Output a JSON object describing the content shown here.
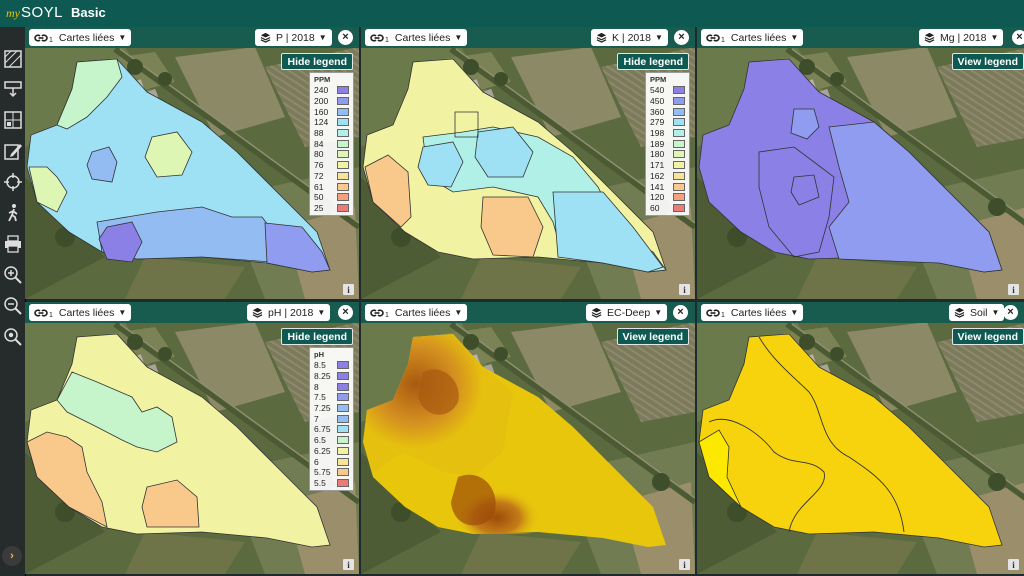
{
  "app": {
    "brand_prefix": "my",
    "brand": "SOYL",
    "plan": "Basic"
  },
  "toolbar": {
    "icons": [
      "map-draw-icon",
      "tray-download-icon",
      "grid-select-icon",
      "edit-icon",
      "crosshair-icon",
      "walking-person-icon",
      "printer-icon",
      "zoom-in-icon",
      "zoom-out-icon",
      "zoom-extent-icon"
    ],
    "toggle_label": "›"
  },
  "panels": [
    {
      "link_label": "Cartes liées",
      "link_count": "1",
      "layer_label": "P | 2018",
      "close_label": "×",
      "legend_button": "Hide legend",
      "legend_visible": true,
      "legend": {
        "unit": "PPM",
        "items": [
          {
            "value": "240",
            "color": "#8a80e6"
          },
          {
            "value": "200",
            "color": "#8f9cef"
          },
          {
            "value": "160",
            "color": "#92bcf2"
          },
          {
            "value": "124",
            "color": "#9ee0f4"
          },
          {
            "value": "88",
            "color": "#b0f0e6"
          },
          {
            "value": "84",
            "color": "#c6f5cc"
          },
          {
            "value": "80",
            "color": "#ddf6b4"
          },
          {
            "value": "76",
            "color": "#f2f3a2"
          },
          {
            "value": "72",
            "color": "#f7e496"
          },
          {
            "value": "61",
            "color": "#f8c98a"
          },
          {
            "value": "50",
            "color": "#f5a27c"
          },
          {
            "value": "25",
            "color": "#ee7a78"
          }
        ]
      },
      "info_label": "i"
    },
    {
      "link_label": "Cartes liées",
      "link_count": "1",
      "layer_label": "K | 2018",
      "close_label": "×",
      "legend_button": "Hide legend",
      "legend_visible": true,
      "legend": {
        "unit": "PPM",
        "items": [
          {
            "value": "540",
            "color": "#8a80e6"
          },
          {
            "value": "450",
            "color": "#8f9cef"
          },
          {
            "value": "360",
            "color": "#92bcf2"
          },
          {
            "value": "279",
            "color": "#9ee0f4"
          },
          {
            "value": "198",
            "color": "#b0f0e6"
          },
          {
            "value": "189",
            "color": "#c6f5cc"
          },
          {
            "value": "180",
            "color": "#ddf6b4"
          },
          {
            "value": "171",
            "color": "#f2f3a2"
          },
          {
            "value": "162",
            "color": "#f7e496"
          },
          {
            "value": "141",
            "color": "#f8c98a"
          },
          {
            "value": "120",
            "color": "#f5a27c"
          },
          {
            "value": "60",
            "color": "#ee7a78"
          }
        ]
      },
      "info_label": "i"
    },
    {
      "link_label": "Cartes liées",
      "link_count": "1",
      "layer_label": "Mg | 2018",
      "close_label": "×",
      "legend_button": "View legend",
      "legend_visible": false,
      "legend": {
        "unit": "",
        "items": []
      },
      "info_label": "i"
    },
    {
      "link_label": "Cartes liées",
      "link_count": "1",
      "layer_label": "pH | 2018",
      "close_label": "×",
      "legend_button": "Hide legend",
      "legend_visible": true,
      "legend": {
        "unit": "pH",
        "items": [
          {
            "value": "8.5",
            "color": "#8a80e6"
          },
          {
            "value": "8.25",
            "color": "#8a80e6"
          },
          {
            "value": "8",
            "color": "#8a80e6"
          },
          {
            "value": "7.5",
            "color": "#8f9cef"
          },
          {
            "value": "7.25",
            "color": "#92bcf2"
          },
          {
            "value": "7",
            "color": "#92bcf2"
          },
          {
            "value": "6.75",
            "color": "#9ee0f4"
          },
          {
            "value": "6.5",
            "color": "#c6f5cc"
          },
          {
            "value": "6.25",
            "color": "#f2f3a2"
          },
          {
            "value": "6",
            "color": "#f7e496"
          },
          {
            "value": "5.75",
            "color": "#f8c98a"
          },
          {
            "value": "5.5",
            "color": "#ee7a78"
          }
        ]
      },
      "info_label": "i"
    },
    {
      "link_label": "Cartes liées",
      "link_count": "1",
      "layer_label": "EC-Deep",
      "close_label": "×",
      "legend_button": "View legend",
      "legend_visible": false,
      "legend": {
        "unit": "",
        "items": []
      },
      "info_label": "i"
    },
    {
      "link_label": "Cartes liées",
      "link_count": "1",
      "layer_label": "Soil",
      "close_label": "×",
      "legend_button": "View legend",
      "legend_visible": false,
      "legend": {
        "unit": "",
        "items": []
      },
      "info_label": "i"
    }
  ]
}
